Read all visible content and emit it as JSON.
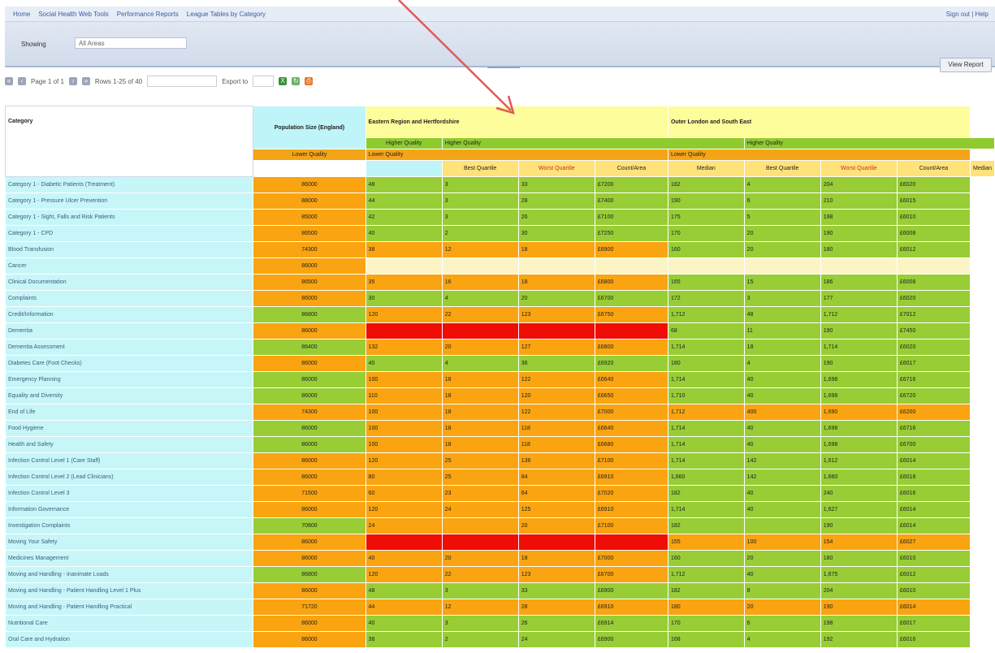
{
  "breadcrumb": {
    "items": [
      "Home",
      "Social Health Web Tools",
      "Performance Reports",
      "League Tables by Category"
    ],
    "right_link": "Sign out | Help"
  },
  "filter": {
    "label": "Showing",
    "value": "All Areas",
    "button_label": "View Report"
  },
  "toolbar": {
    "page_label": "Page 1 of 1",
    "rows_label": "Rows 1-25 of 40",
    "export_label": "Export to"
  },
  "table": {
    "header": {
      "category": "Category",
      "population": "Population Size (England)",
      "regions": [
        "Eastern Region and Hertfordshire",
        "Outer London and South East"
      ],
      "status_green": "Higher Quality",
      "status_orange": "Lower Quality",
      "subheaders": [
        "Best Quartile",
        "Worst Quartile",
        "Count/Area",
        "Median"
      ]
    },
    "rows": [
      {
        "label": "Category 1 - Diabetic Patients (Treatment)",
        "pop": "86000",
        "popc": "o",
        "cells": [
          [
            "48",
            "3",
            "33",
            "£7200"
          ],
          [
            "182",
            "4",
            "204",
            "£6020"
          ]
        ],
        "colors": [
          "g",
          "g"
        ]
      },
      {
        "label": "Category 1 - Pressure Ulcer Prevention",
        "pop": "88000",
        "popc": "o",
        "cells": [
          [
            "44",
            "3",
            "28",
            "£7400"
          ],
          [
            "190",
            "6",
            "210",
            "£6015"
          ]
        ],
        "colors": [
          "g",
          "g"
        ]
      },
      {
        "label": "Category 1 - Sight, Falls and Risk Patients",
        "pop": "85000",
        "popc": "o",
        "cells": [
          [
            "42",
            "3",
            "26",
            "£7100"
          ],
          [
            "175",
            "5",
            "198",
            "£6010"
          ]
        ],
        "colors": [
          "g",
          "g"
        ]
      },
      {
        "label": "Category 1 - CPD",
        "pop": "86500",
        "popc": "o",
        "cells": [
          [
            "40",
            "2",
            "30",
            "£7250"
          ],
          [
            "170",
            "20",
            "190",
            "£6008"
          ]
        ],
        "colors": [
          "g",
          "g"
        ]
      },
      {
        "label": "Blood Transfusion",
        "pop": "74300",
        "popc": "o",
        "cells": [
          [
            "38",
            "12",
            "18",
            "£6900"
          ],
          [
            "160",
            "20",
            "180",
            "£6012"
          ]
        ],
        "colors": [
          "o",
          "g"
        ]
      },
      {
        "label": "Cancer",
        "pop": "86000",
        "popc": "o",
        "cells": [
          [
            "",
            "",
            "",
            ""
          ],
          [
            "",
            "",
            "",
            ""
          ]
        ],
        "colors": [
          "y",
          "y"
        ]
      },
      {
        "label": "Clinical Documentation",
        "pop": "86500",
        "popc": "o",
        "cells": [
          [
            "35",
            "16",
            "18",
            "£6800"
          ],
          [
            "165",
            "15",
            "186",
            "£6008"
          ]
        ],
        "colors": [
          "o",
          "g"
        ]
      },
      {
        "label": "Complaints",
        "pop": "86000",
        "popc": "o",
        "cells": [
          [
            "30",
            "4",
            "20",
            "£6700"
          ],
          [
            "172",
            "3",
            "177",
            "£6020"
          ]
        ],
        "colors": [
          "g",
          "g"
        ]
      },
      {
        "label": "Credit/Information",
        "pop": "86800",
        "popc": "g",
        "cells": [
          [
            "120",
            "22",
            "123",
            "£6750"
          ],
          [
            "1,712",
            "48",
            "1,712",
            "£7012"
          ]
        ],
        "colors": [
          "o",
          "g"
        ]
      },
      {
        "label": "Dementia",
        "pop": "86000",
        "popc": "o",
        "cells": [
          [
            "",
            "",
            "",
            ""
          ],
          [
            "68",
            "11",
            "190",
            "£7450"
          ]
        ],
        "colors": [
          "r",
          "g"
        ]
      },
      {
        "label": "Dementia Assessment",
        "pop": "86400",
        "popc": "g",
        "cells": [
          [
            "132",
            "20",
            "127",
            "£6800"
          ],
          [
            "1,714",
            "18",
            "1,714",
            "£6020"
          ]
        ],
        "colors": [
          "o",
          "g"
        ]
      },
      {
        "label": "Diabetes Care (Foot Checks)",
        "pop": "86000",
        "popc": "o",
        "cells": [
          [
            "40",
            "4",
            "36",
            "£6920"
          ],
          [
            "180",
            "4",
            "190",
            "£6017"
          ]
        ],
        "colors": [
          "g",
          "g"
        ]
      },
      {
        "label": "Emergency Planning",
        "pop": "86000",
        "popc": "g",
        "cells": [
          [
            "100",
            "18",
            "122",
            "£6640"
          ],
          [
            "1,714",
            "40",
            "1,698",
            "£6716"
          ]
        ],
        "colors": [
          "o",
          "g"
        ]
      },
      {
        "label": "Equality and Diversity",
        "pop": "86000",
        "popc": "g",
        "cells": [
          [
            "110",
            "18",
            "120",
            "£6650"
          ],
          [
            "1,710",
            "40",
            "1,698",
            "£6720"
          ]
        ],
        "colors": [
          "o",
          "g"
        ]
      },
      {
        "label": "End of Life",
        "pop": "74300",
        "popc": "o",
        "cells": [
          [
            "100",
            "18",
            "122",
            "£7000"
          ],
          [
            "1,712",
            "400",
            "1,690",
            "£6200"
          ]
        ],
        "colors": [
          "o",
          "o"
        ]
      },
      {
        "label": "Food Hygiene",
        "pop": "86000",
        "popc": "g",
        "cells": [
          [
            "100",
            "18",
            "118",
            "£6640"
          ],
          [
            "1,714",
            "40",
            "1,698",
            "£6716"
          ]
        ],
        "colors": [
          "o",
          "g"
        ]
      },
      {
        "label": "Health and Safety",
        "pop": "86000",
        "popc": "g",
        "cells": [
          [
            "100",
            "18",
            "118",
            "£6680"
          ],
          [
            "1,714",
            "40",
            "1,698",
            "£6700"
          ]
        ],
        "colors": [
          "o",
          "g"
        ]
      },
      {
        "label": "Infection Control Level 1 (Care Staff)",
        "pop": "86000",
        "popc": "o",
        "cells": [
          [
            "120",
            "25",
            "136",
            "£7100"
          ],
          [
            "1,714",
            "142",
            "1,612",
            "£6014"
          ]
        ],
        "colors": [
          "o",
          "g"
        ]
      },
      {
        "label": "Infection Control Level 2 (Lead Clinicians)",
        "pop": "86000",
        "popc": "o",
        "cells": [
          [
            "80",
            "25",
            "84",
            "£6910"
          ],
          [
            "1,660",
            "142",
            "1,660",
            "£6018"
          ]
        ],
        "colors": [
          "o",
          "g"
        ]
      },
      {
        "label": "Infection Control Level 3",
        "pop": "71500",
        "popc": "o",
        "cells": [
          [
            "60",
            "23",
            "64",
            "£7020"
          ],
          [
            "182",
            "40",
            "240",
            "£6016"
          ]
        ],
        "colors": [
          "o",
          "g"
        ]
      },
      {
        "label": "Information Governance",
        "pop": "86000",
        "popc": "o",
        "cells": [
          [
            "120",
            "24",
            "125",
            "£6910"
          ],
          [
            "1,714",
            "40",
            "1,627",
            "£6014"
          ]
        ],
        "colors": [
          "o",
          "g"
        ]
      },
      {
        "label": "Investigation Complaints",
        "pop": "70800",
        "popc": "g",
        "cells": [
          [
            "24",
            "",
            "20",
            "£7100"
          ],
          [
            "182",
            "",
            "190",
            "£6014"
          ]
        ],
        "colors": [
          "o",
          "g"
        ]
      },
      {
        "label": "Moving Your Safety",
        "pop": "86000",
        "popc": "o",
        "cells": [
          [
            "",
            "",
            "",
            ""
          ],
          [
            "155",
            "100",
            "154",
            "£6027"
          ]
        ],
        "colors": [
          "r",
          "o"
        ]
      },
      {
        "label": "Medicines Management",
        "pop": "86000",
        "popc": "o",
        "cells": [
          [
            "40",
            "20",
            "18",
            "£7000"
          ],
          [
            "160",
            "20",
            "180",
            "£6010"
          ]
        ],
        "colors": [
          "o",
          "g"
        ]
      },
      {
        "label": "Moving and Handling - Inanimate Loads",
        "pop": "86800",
        "popc": "g",
        "cells": [
          [
            "120",
            "22",
            "123",
            "£6700"
          ],
          [
            "1,712",
            "40",
            "1,675",
            "£6012"
          ]
        ],
        "colors": [
          "o",
          "g"
        ]
      },
      {
        "label": "Moving and Handling - Patient Handling Level 1 Plus",
        "pop": "86000",
        "popc": "o",
        "cells": [
          [
            "48",
            "3",
            "33",
            "£6900"
          ],
          [
            "182",
            "8",
            "204",
            "£6010"
          ]
        ],
        "colors": [
          "g",
          "g"
        ]
      },
      {
        "label": "Moving and Handling - Patient Handling Practical",
        "pop": "71720",
        "popc": "o",
        "cells": [
          [
            "44",
            "12",
            "28",
            "£6910"
          ],
          [
            "180",
            "20",
            "190",
            "£6014"
          ]
        ],
        "colors": [
          "o",
          "o"
        ]
      },
      {
        "label": "Nutritional Care",
        "pop": "86000",
        "popc": "o",
        "cells": [
          [
            "40",
            "3",
            "26",
            "£6914"
          ],
          [
            "170",
            "6",
            "198",
            "£6017"
          ]
        ],
        "colors": [
          "g",
          "g"
        ]
      },
      {
        "label": "Oral Care and Hydration",
        "pop": "86000",
        "popc": "o",
        "cells": [
          [
            "38",
            "2",
            "24",
            "£6900"
          ],
          [
            "168",
            "4",
            "192",
            "£6016"
          ]
        ],
        "colors": [
          "g",
          "g"
        ]
      }
    ]
  },
  "colors": {
    "green": "#98cd36",
    "orange": "#f9a410",
    "red": "#ef0d06",
    "cyan": "#c7f6f9",
    "yellow_header": "#fdfd9b",
    "arrow": "#e05a5a"
  },
  "icons": [
    "first-page-icon",
    "prev-page-icon",
    "next-page-icon",
    "last-page-icon",
    "excel-icon",
    "refresh-icon",
    "print-icon"
  ]
}
